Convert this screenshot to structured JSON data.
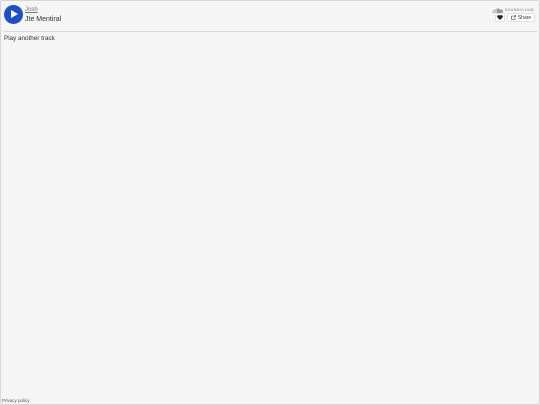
{
  "header": {
    "artist": "Josh",
    "track_title": "Jte Mentiral",
    "logo_text": "SOUNDCLOUD",
    "share_label": "Share"
  },
  "main": {
    "heading": "Play another track"
  },
  "footer": {
    "privacy_label": "Privacy policy"
  },
  "colors": {
    "play_button": "#1f4fc4",
    "background": "#f5f5f5",
    "logo": "#999999"
  },
  "icons": {
    "play": "play-icon",
    "soundcloud": "soundcloud-cloud-icon",
    "like": "heart-icon",
    "share": "share-icon"
  }
}
